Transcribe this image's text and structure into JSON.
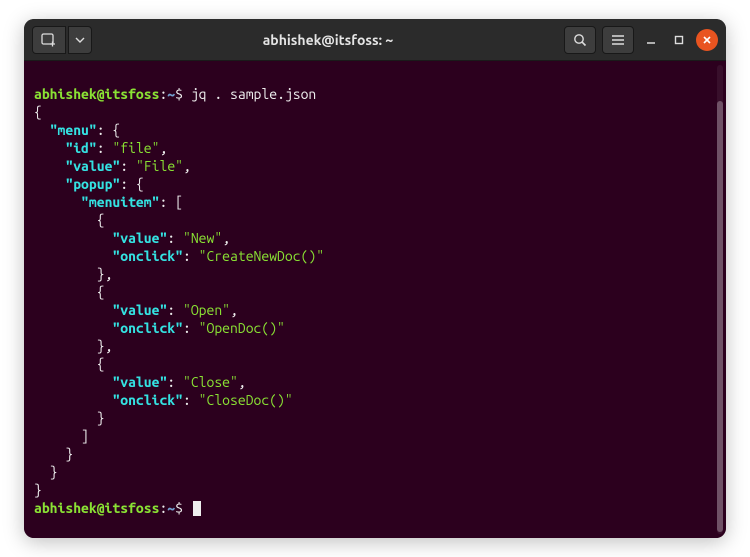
{
  "window": {
    "title": "abhishek@itsfoss: ~"
  },
  "prompt": {
    "user_host": "abhishek@itsfoss",
    "separator": ":",
    "path": "~",
    "symbol": "$"
  },
  "command": "jq . sample.json",
  "output": {
    "menu_key": "\"menu\"",
    "id_key": "\"id\"",
    "id_val": "\"file\"",
    "value_key": "\"value\"",
    "value_val": "\"File\"",
    "popup_key": "\"popup\"",
    "menuitem_key": "\"menuitem\"",
    "item_value_key": "\"value\"",
    "item_onclick_key": "\"onclick\"",
    "i1_value": "\"New\"",
    "i1_onclick": "\"CreateNewDoc()\"",
    "i2_value": "\"Open\"",
    "i2_onclick": "\"OpenDoc()\"",
    "i3_value": "\"Close\"",
    "i3_onclick": "\"CloseDoc()\""
  }
}
